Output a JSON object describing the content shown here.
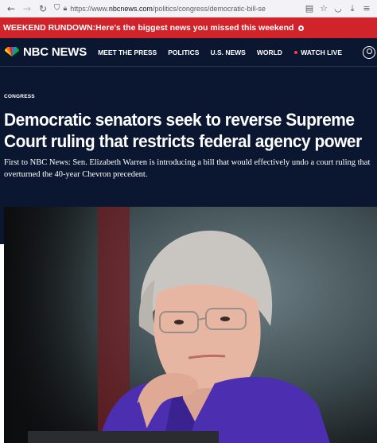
{
  "browser": {
    "back_icon": "arrow-left-icon",
    "forward_icon": "arrow-right-icon",
    "reload_icon": "reload-icon",
    "url_prefix": "https://www.",
    "url_domain": "nbcnews.com",
    "url_path": "/politics/congress/democratic-bill-se"
  },
  "banner": {
    "label": "WEEKEND RUNDOWN:",
    "text": " Here's the biggest news you missed this weekend"
  },
  "nav": {
    "logo": "NBC NEWS",
    "items": [
      "MEET THE PRESS",
      "POLITICS",
      "U.S. NEWS",
      "WORLD"
    ],
    "watch_live": "WATCH LIVE"
  },
  "article": {
    "eyebrow": "CONGRESS",
    "headline": "Democratic senators seek to reverse Supreme Court ruling that restricts federal agency power",
    "dek": "First to NBC News: Sen. Elizabeth Warren is introducing a bill that would effectively undo a court ruling that overturned the 40-year Chevron precedent."
  },
  "colors": {
    "banner_red": "#d1232a",
    "navy": "#0b1731",
    "blazer_purple": "#4b2fb0"
  }
}
